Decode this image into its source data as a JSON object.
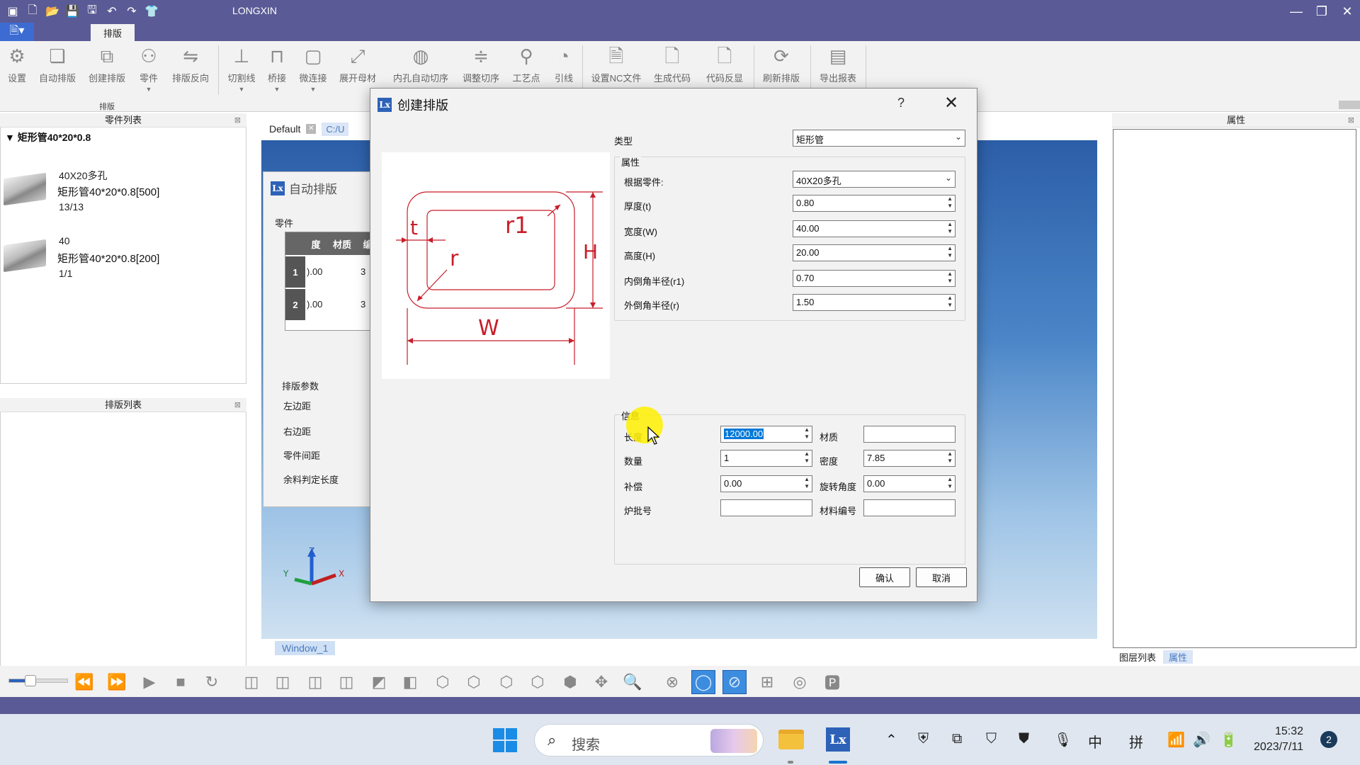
{
  "app": {
    "title": "LONGXIN"
  },
  "ribbon": {
    "active_tab": "排版",
    "group_label": "排版",
    "buttons": [
      {
        "label": "设置",
        "icon": "gear-icon"
      },
      {
        "label": "自动排版",
        "icon": "auto-nest-icon"
      },
      {
        "label": "创建排版",
        "icon": "create-nest-icon"
      },
      {
        "label": "零件",
        "icon": "part-icon"
      },
      {
        "label": "排版反向",
        "icon": "reverse-icon"
      },
      {
        "label": "切割线",
        "icon": "cut-line-icon"
      },
      {
        "label": "桥接",
        "icon": "bridge-icon"
      },
      {
        "label": "微连接",
        "icon": "micro-joint-icon"
      },
      {
        "label": "展开母材",
        "icon": "expand-icon"
      },
      {
        "label": "内孔自动切序",
        "icon": "hole-order-icon"
      },
      {
        "label": "调整切序",
        "icon": "adjust-order-icon"
      },
      {
        "label": "工艺点",
        "icon": "process-point-icon"
      },
      {
        "label": "引线",
        "icon": "lead-line-icon"
      },
      {
        "label": "设置NC文件",
        "icon": "nc-file-icon"
      },
      {
        "label": "生成代码",
        "icon": "generate-code-icon"
      },
      {
        "label": "代码反显",
        "icon": "code-display-icon"
      },
      {
        "label": "刷新排版",
        "icon": "refresh-icon"
      },
      {
        "label": "导出报表",
        "icon": "export-report-icon"
      }
    ]
  },
  "parts_panel": {
    "title": "零件列表",
    "root": "矩形管40*20*0.8",
    "items": [
      {
        "name": "40X20多孔",
        "spec": "矩形管40*20*0.8[500]",
        "count": "13/13"
      },
      {
        "name": "40",
        "spec": "矩形管40*20*0.8[200]",
        "count": "1/1"
      }
    ]
  },
  "nest_panel": {
    "title": "排版列表"
  },
  "doc_tabs": {
    "tab1": "Default",
    "tab2": "C:/U"
  },
  "bg_dialog": {
    "title": "自动排版",
    "parts_group": "零件",
    "headers": [
      "度",
      "材质",
      "编"
    ],
    "rows": [
      {
        "no": "1",
        "len": ").00",
        "qty": "3"
      },
      {
        "no": "2",
        "len": ").00",
        "qty": "3"
      }
    ],
    "params_group": "排版参数",
    "params": [
      "左边距",
      "右边距",
      "零件间距",
      "余料判定长度"
    ]
  },
  "window_tab": "Window_1",
  "right_panel": {
    "title": "属性",
    "tabs": [
      "图层列表",
      "属性"
    ]
  },
  "dialog": {
    "title": "创建排版",
    "help": "?",
    "type_label": "类型",
    "type_value": "矩形管",
    "props_group": "属性",
    "props": [
      {
        "label": "根据零件:",
        "value": "40X20多孔",
        "kind": "combo"
      },
      {
        "label": "厚度(t)",
        "value": "0.80",
        "kind": "spin"
      },
      {
        "label": "宽度(W)",
        "value": "40.00",
        "kind": "spin"
      },
      {
        "label": "高度(H)",
        "value": "20.00",
        "kind": "spin"
      },
      {
        "label": "内倒角半径(r1)",
        "value": "0.70",
        "kind": "spin"
      },
      {
        "label": "外倒角半径(r)",
        "value": "1.50",
        "kind": "spin"
      }
    ],
    "diagram": {
      "t": "t",
      "r1": "r1",
      "r": "r",
      "H": "H",
      "W": "W"
    },
    "info_group": "信息",
    "info": {
      "length_label": "长度",
      "length_value": "12000.00",
      "material_label": "材质",
      "material_value": "",
      "qty_label": "数量",
      "qty_value": "1",
      "density_label": "密度",
      "density_value": "7.85",
      "comp_label": "补偿",
      "comp_value": "0.00",
      "rotate_label": "旋转角度",
      "rotate_value": "0.00",
      "batch_label": "炉批号",
      "batch_value": "",
      "matno_label": "材料编号",
      "matno_value": ""
    },
    "ok": "确认",
    "cancel": "取消"
  },
  "taskbar": {
    "search_placeholder": "搜索",
    "time": "15:32",
    "date": "2023/7/11",
    "ime1": "中",
    "ime2": "拼",
    "notifications": "2"
  }
}
